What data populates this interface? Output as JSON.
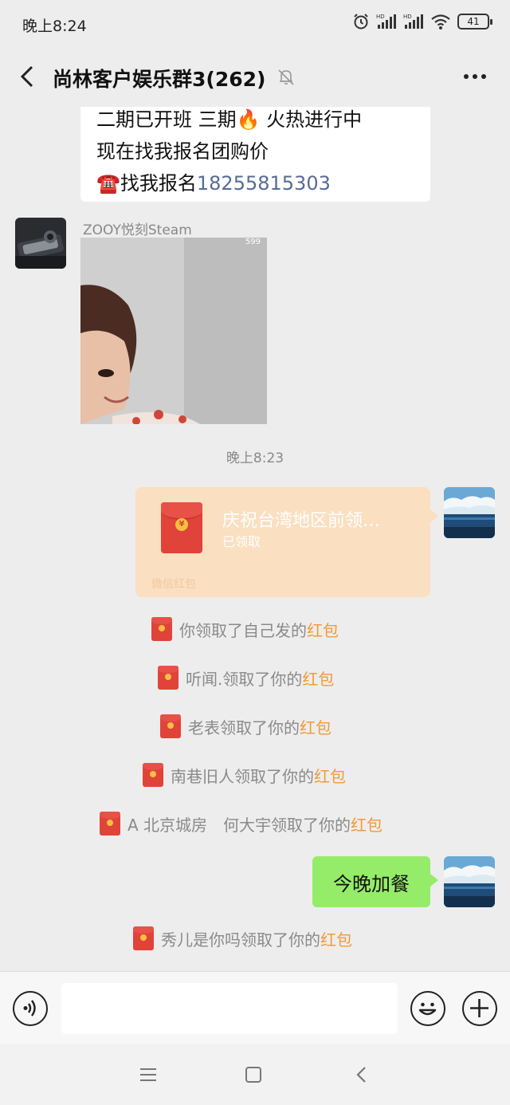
{
  "status_bar": {
    "time": "晚上8:24",
    "battery": "41"
  },
  "header": {
    "title": "尚林客户娱乐群3(262)"
  },
  "messages": {
    "partial_message": {
      "line1": "二期已开班 三期🔥 火热进行中",
      "line2": "现在找我报名团购价",
      "line3_prefix": "☎️找我报名",
      "phone": "18255815303"
    },
    "image_message": {
      "sender": "ZOOY悦刻Steam",
      "image_badge": "599"
    },
    "time_separator": "晚上8:23",
    "red_packet": {
      "title": "庆祝台湾地区前领…",
      "status": "已领取",
      "footer": "微信红包",
      "coin": "¥"
    },
    "system_notices": [
      {
        "prefix": "你领取了自己发的",
        "link": "红包"
      },
      {
        "prefix": "听闻.领取了你的",
        "link": "红包"
      },
      {
        "prefix": "老表领取了你的",
        "link": "红包"
      },
      {
        "prefix": "南巷旧人领取了你的",
        "link": "红包"
      },
      {
        "prefix": "A 北京城房　何大宇领取了你的",
        "link": "红包"
      }
    ],
    "my_text": "今晚加餐",
    "last_notice": {
      "prefix": "秀儿是你吗领取了你的",
      "link": "红包"
    }
  },
  "colors": {
    "background": "#ededed",
    "green_bubble": "#95ec69",
    "red_packet": "#fadfc0",
    "red_packet_link": "#f29a38",
    "phone_link": "#576b95"
  }
}
